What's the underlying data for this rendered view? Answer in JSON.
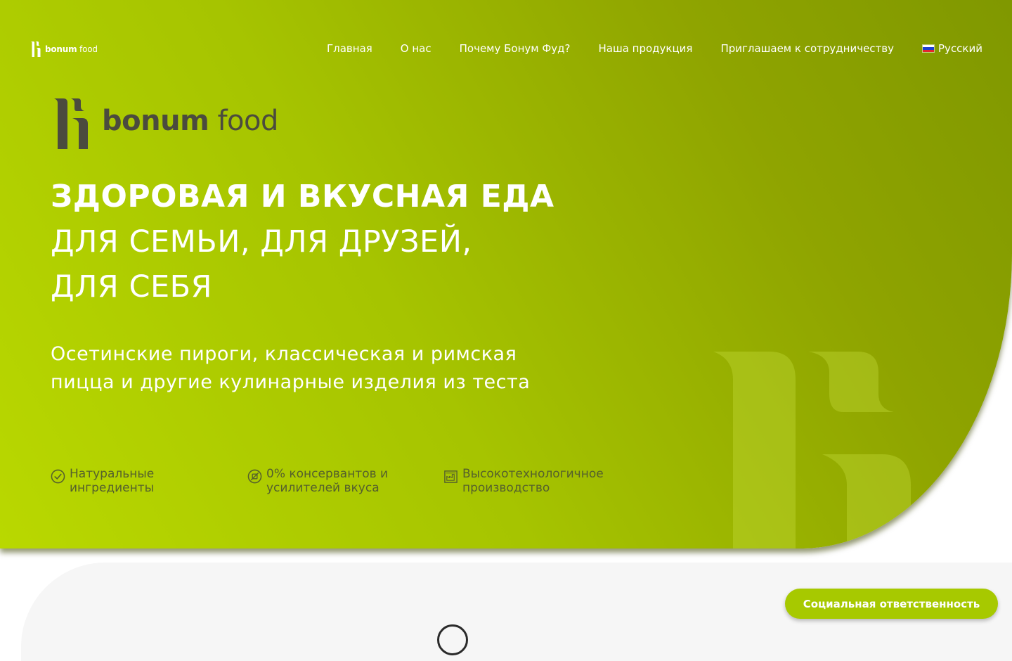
{
  "brand": {
    "name_bold": "bonum",
    "name_light": " food"
  },
  "nav": {
    "items": [
      {
        "label": "Главная"
      },
      {
        "label": "О нас"
      },
      {
        "label": "Почему Бонум Фуд?"
      },
      {
        "label": "Наша продукция"
      },
      {
        "label": "Приглашаем к сотрудничеству"
      }
    ],
    "language": "Русский"
  },
  "hero": {
    "headline_line1": "ЗДОРОВАЯ И ВКУСНАЯ ЕДА",
    "headline_line2": "ДЛЯ СЕМЬИ, ДЛЯ ДРУЗЕЙ,",
    "headline_line3": "ДЛЯ СЕБЯ",
    "lead": "Осетинские пироги, классическая и римская пицца и другие кулинарные изделия из теста",
    "features": [
      {
        "icon": "check-circle-icon",
        "label": "Натуральные ингредиенты"
      },
      {
        "icon": "no-additives-icon",
        "label": "0% консервантов и усилителей вкуса"
      },
      {
        "icon": "factory-icon",
        "label": "Высокотехнологичное производство"
      }
    ]
  },
  "cta": {
    "label": "Социальная ответственность"
  },
  "colors": {
    "accent": "#a7c900",
    "gradient_start": "#b9d800",
    "gradient_end": "#809800",
    "logo_dark": "#4b4b3e",
    "feature_text": "#55602c"
  }
}
